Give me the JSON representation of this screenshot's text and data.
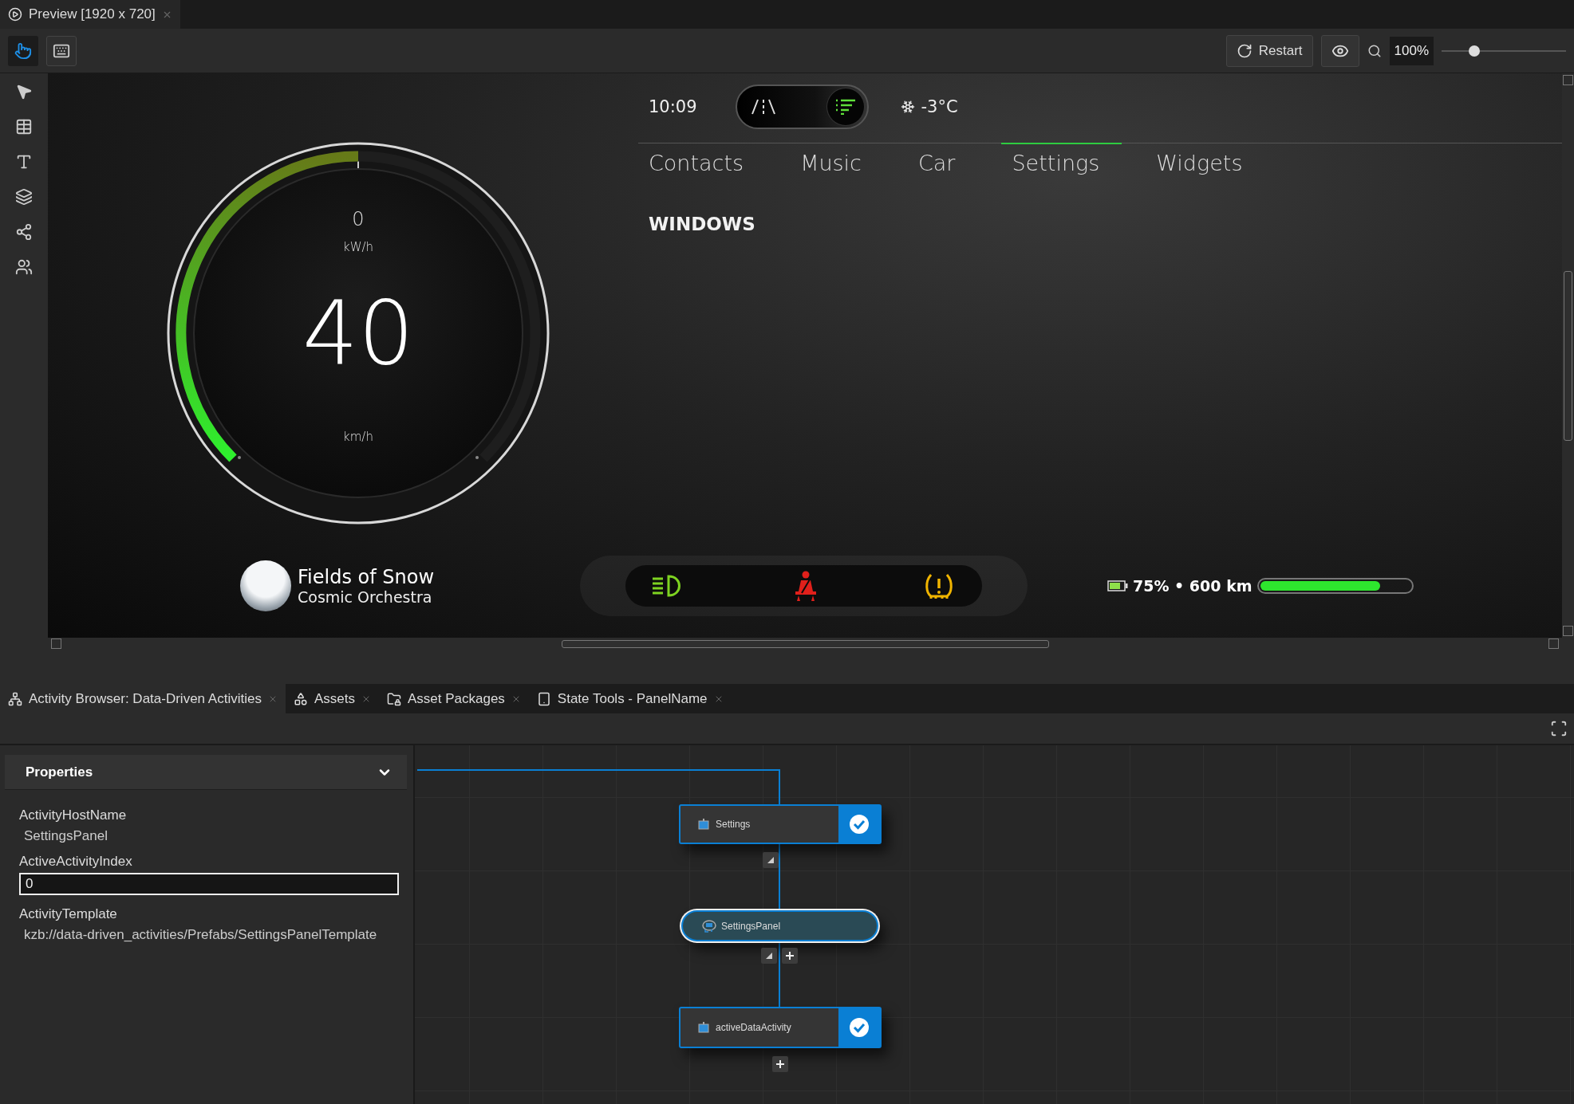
{
  "preview_tab": {
    "title": "Preview [1920 x 720]"
  },
  "toolbar": {
    "tools": [
      {
        "kind": "pointer",
        "selected": true
      },
      {
        "kind": "keyboard",
        "selected": false
      }
    ],
    "restart_label": "Restart",
    "zoom_value": "100%",
    "zoom_slider": {
      "level": 0.26
    }
  },
  "dashboard": {
    "time": "10:09",
    "drive_modes": [
      {
        "kind": "road",
        "selected": false
      },
      {
        "kind": "list",
        "selected": true
      }
    ],
    "temperature": "-3°C",
    "nav": [
      {
        "label": "Contacts",
        "selected": false
      },
      {
        "label": "Music",
        "selected": false
      },
      {
        "label": "Car",
        "selected": false
      },
      {
        "label": "Settings",
        "selected": true
      },
      {
        "label": "Widgets",
        "selected": false
      }
    ],
    "heading": "WINDOWS",
    "gauge": {
      "power": "0",
      "power_unit": "kW/h",
      "speed": "40",
      "speed_unit": "km/h",
      "level": 0.5
    },
    "track": {
      "title": "Fields of Snow",
      "artist": "Cosmic Orchestra"
    },
    "warnings": [
      {
        "kind": "headlight",
        "color": "#7ed321"
      },
      {
        "kind": "seatbelt",
        "color": "#e0201b"
      },
      {
        "kind": "tire_pressure",
        "color": "#f0b400"
      }
    ],
    "battery": {
      "reading": "75% • 600 km",
      "level": 0.8
    }
  },
  "panel_tabs": [
    {
      "label": "Activity Browser: Data-Driven Activities",
      "kind": "activity",
      "selected": true
    },
    {
      "label": "Assets",
      "kind": "assets",
      "selected": false
    },
    {
      "label": "Asset Packages",
      "kind": "packages",
      "selected": false
    },
    {
      "label": "State Tools - PanelName",
      "kind": "state",
      "selected": false
    }
  ],
  "properties": {
    "title": "Properties",
    "expanded": true,
    "fields": [
      {
        "label": "ActivityHostName",
        "kind": "text",
        "value": "SettingsPanel"
      },
      {
        "label": "ActiveActivityIndex",
        "kind": "input",
        "value": "0"
      },
      {
        "label": "ActivityTemplate",
        "kind": "text",
        "value": "kzb://data-driven_activities/Prefabs/SettingsPanelTemplate"
      }
    ]
  },
  "graph": {
    "nodes": [
      {
        "kind": "activity",
        "label": "Settings",
        "active": true
      },
      {
        "kind": "host",
        "label": "SettingsPanel",
        "selected": true
      },
      {
        "kind": "activity",
        "label": "activeDataActivity",
        "active": true
      }
    ]
  }
}
